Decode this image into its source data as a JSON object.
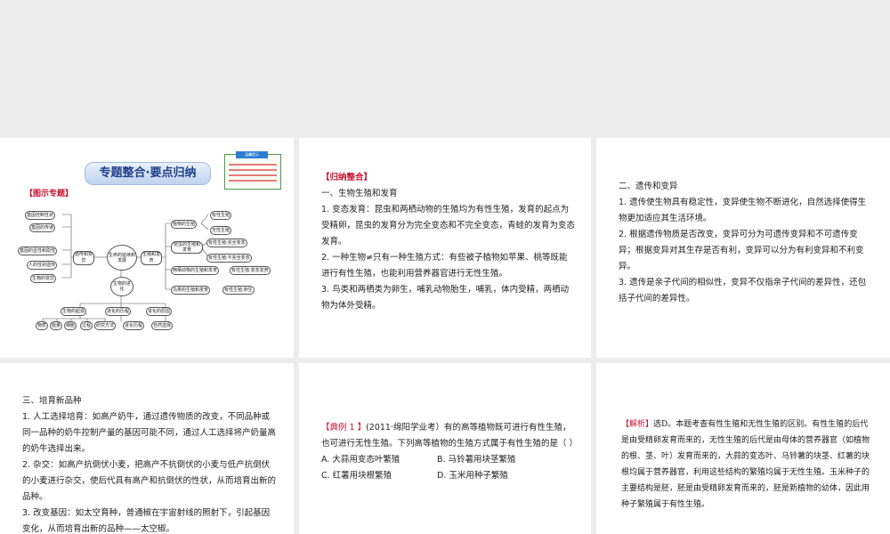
{
  "slide1": {
    "banner": "专题整合·要点归纳",
    "section": "【图示专题】",
    "note_tag": "温馨提示",
    "map": {
      "left": [
        "基因控制性状",
        "基因的传递",
        "基因的显性和隐性",
        "人的性别遗传",
        "生物的变异"
      ],
      "mid_left": "遗传和变异",
      "center": "生命的延续和发展",
      "mid_right": "生殖和发育",
      "bottom_center": "生物的进化",
      "right_cat": [
        "植物的生殖",
        "昆虫的生殖和发育",
        "两栖动物的生殖和发育",
        "鸟类的生殖和发育"
      ],
      "far_right": [
        "有性生殖",
        "无性生殖",
        "有性生殖:完全变态",
        "有性生殖:不完全变态",
        "有性生殖:变态发育",
        "有性生殖:卵生"
      ],
      "evo": [
        "生物的起源",
        "进化的历程",
        "进化的原因"
      ],
      "evo_sub": [
        "物质",
        "能量",
        "细胞",
        "过程",
        "研究方法",
        "进化历程",
        "自然选择"
      ]
    }
  },
  "slide2": {
    "header": "【归纳整合】",
    "subtitle": "一、生物生殖和发育",
    "paras": [
      "1. 变态发育：昆虫和两栖动物的生殖均为有性生殖，发育的起点为受精卵，昆虫的发育分为完全变态和不完全变态，青蛙的发育为变态发育。",
      "2. 一种生物≠只有一种生殖方式：有些被子植物如苹果、桃等既能进行有性生殖，也能利用营养器官进行无性生殖。",
      "3. 鸟类和两栖类为卵生，哺乳动物胎生，哺乳，体内受精，两栖动物为体外受精。"
    ]
  },
  "slide3": {
    "subtitle": "二、遗传和变异",
    "paras": [
      "1. 遗传使生物具有稳定性，变异使生物不断进化，自然选择使得生物更加适应其生活环境。",
      "2. 根据遗传物质是否改变，变异可分为可遗传变异和不可遗传变异；根据变异对其生存是否有利，变异可以分为有利变异和不利变异。",
      "3. 遗传是亲子代间的相似性，变异不仅指亲子代间的差异性，还包括子代间的差异性。"
    ]
  },
  "slide4": {
    "subtitle": "三、培育新品种",
    "paras": [
      "1. 人工选择培育：如高产奶牛，通过遗传物质的改变，不同品种或同一品种的奶牛控制产量的基因可能不同，通过人工选择将产奶量高的奶牛选择出来。",
      "2. 杂交：如高产抗倒伏小麦，把高产不抗倒伏的小麦与低产抗倒伏的小麦进行杂交，使后代具有高产和抗倒伏的性状，从而培育出新的品种。",
      "3. 改变基因：如太空育种，普通椒在宇宙射线的照射下，引起基因变化，从而培育出新的品种——太空椒。"
    ]
  },
  "slide5": {
    "label": "【典例 1 】",
    "question": "(2011·绵阳学业考）有的高等植物既可进行有性生殖，也可进行无性生殖。下列高等植物的生殖方式属于有性生殖的是（    ）",
    "options": [
      "A. 大蒜用变态叶繁殖",
      "B. 马铃薯用块茎繁殖",
      "C. 红薯用块根繁殖",
      "D. 玉米用种子繁殖"
    ]
  },
  "slide6": {
    "label": "【解析】",
    "text": "选D。本题考查有性生殖和无性生殖的区别。有性生殖的后代是由受精卵发育而来的，无性生殖的后代是由母体的营养器官（如植物的根、茎、叶）发育而来的，大蒜的变态叶、马铃薯的块茎、红薯的块根均属于营养器官，利用这些结构的繁殖均属于无性生殖。玉米种子的主要结构是胚，胚是由受精卵发育而来的，胚是新植物的幼体，因此用种子繁殖属于有性生殖。"
  }
}
